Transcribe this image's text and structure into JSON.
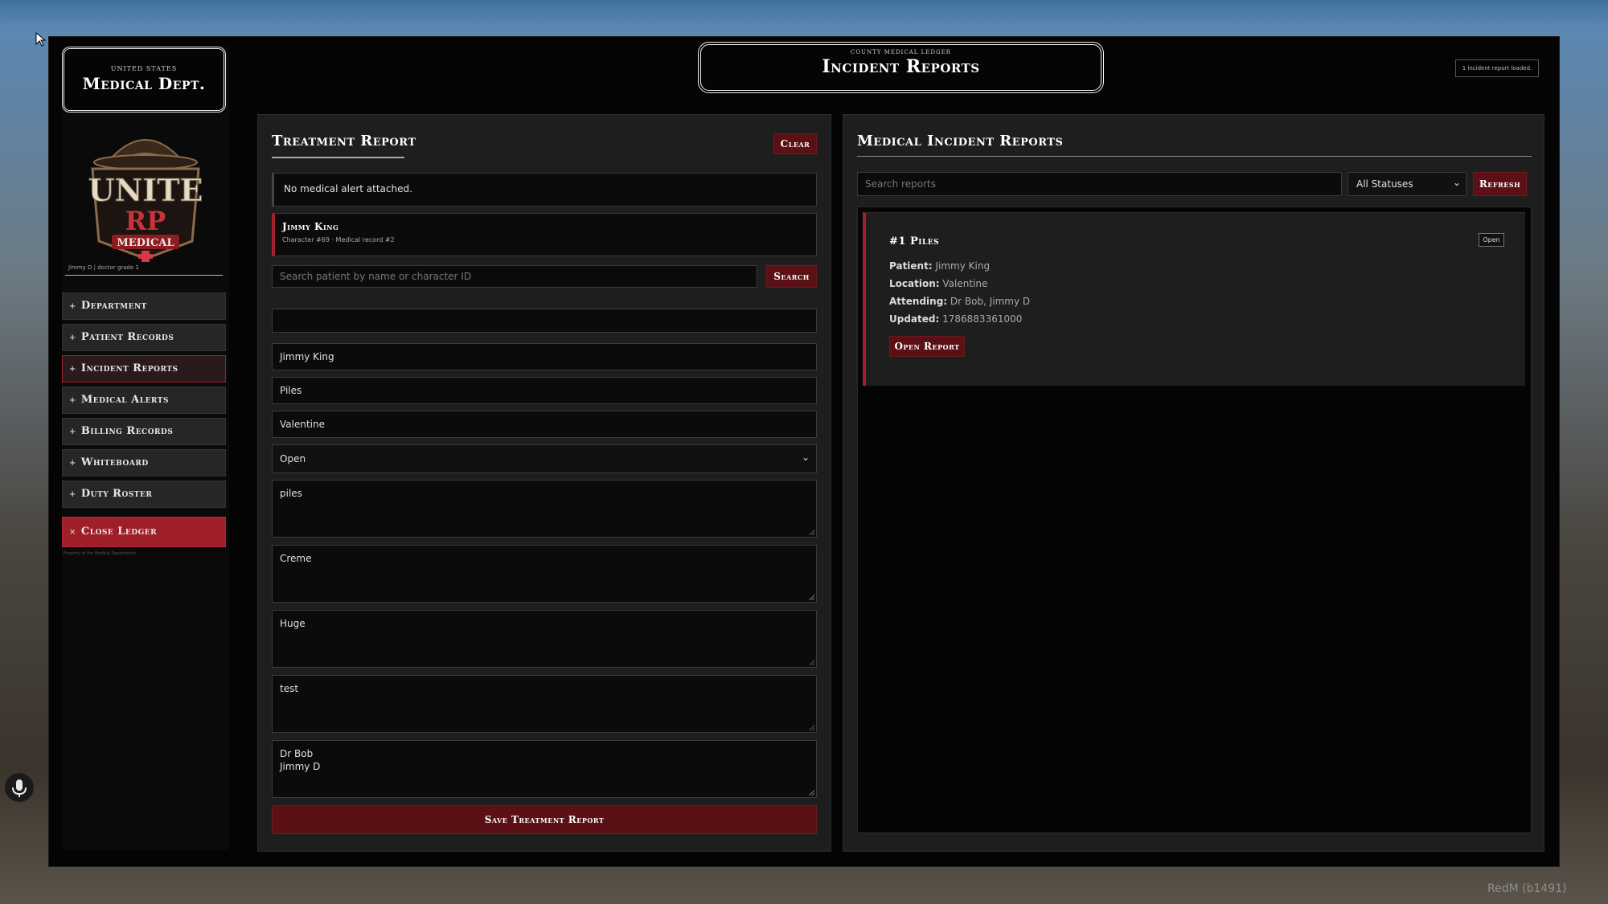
{
  "header": {
    "kicker": "COUNTY MEDICAL LEDGER",
    "title": "Incident Reports",
    "status": "1 incident report loaded."
  },
  "sidebar": {
    "kicker": "UNITED STATES",
    "title": "Medical Dept.",
    "logo_text": {
      "top": "UNITE",
      "mid": "RP",
      "bottom": "MEDICAL"
    },
    "user": "Jimmy D | doctor grade 1",
    "items": [
      {
        "label": "Department",
        "active": false
      },
      {
        "label": "Patient Records",
        "active": false
      },
      {
        "label": "Incident Reports",
        "active": true
      },
      {
        "label": "Medical Alerts",
        "active": false
      },
      {
        "label": "Billing Records",
        "active": false
      },
      {
        "label": "Whiteboard",
        "active": false
      },
      {
        "label": "Duty Roster",
        "active": false
      }
    ],
    "close_label": "Close Ledger",
    "footer": "Property of the Medical Department"
  },
  "treatment": {
    "title": "Treatment Report",
    "clear_label": "Clear",
    "alert_text": "No medical alert attached.",
    "patient_name": "Jimmy King",
    "patient_meta": "Character #69 · Medical record #2",
    "search_placeholder": "Search patient by name or character ID",
    "search_label": "Search",
    "fields": {
      "empty": "",
      "patient": "Jimmy King",
      "title": "Piles",
      "location": "Valentine",
      "status": "Open",
      "complaint": "piles",
      "treatment": "Creme",
      "notes": "Huge",
      "extra": "test",
      "attending": "Dr Bob\nJimmy D"
    },
    "save_label": "Save Treatment Report"
  },
  "reports": {
    "title": "Medical Incident Reports",
    "search_placeholder": "Search reports",
    "status_filter": "All Statuses",
    "refresh_label": "Refresh",
    "items": [
      {
        "title": "#1 Piles",
        "status": "Open",
        "patient_label": "Patient:",
        "patient": "Jimmy King",
        "location_label": "Location:",
        "location": "Valentine",
        "attending_label": "Attending:",
        "attending": "Dr Bob, Jimmy D",
        "updated_label": "Updated:",
        "updated": "1786883361000",
        "open_label": "Open Report"
      }
    ]
  },
  "overlay": {
    "watermark": "RedM (b1491)"
  },
  "colors": {
    "accent": "#a3202a",
    "button": "#5a1014",
    "panel": "#1e1e1e",
    "field": "#0b0b0b"
  }
}
